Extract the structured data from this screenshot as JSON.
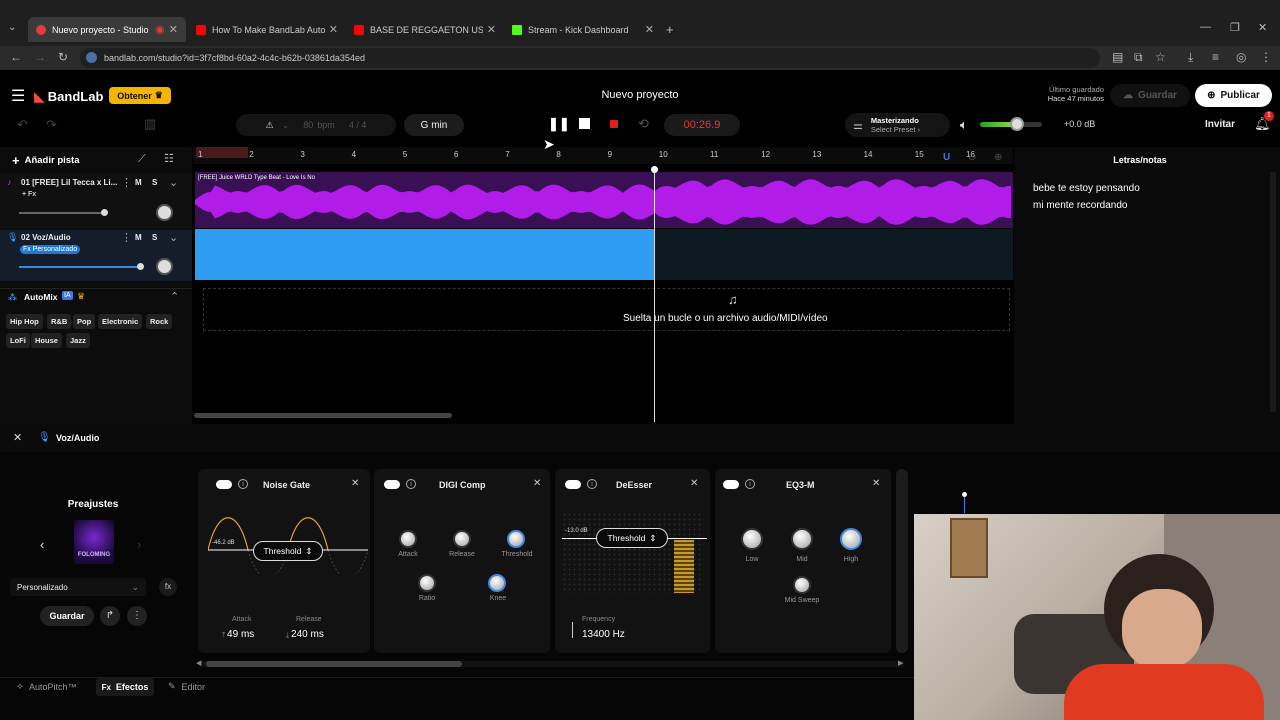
{
  "browser": {
    "tabs": [
      {
        "title": "Nuevo proyecto - Studio",
        "color": "#e23b3b",
        "active": true
      },
      {
        "title": "How To Make BandLab AutoTu",
        "color": "#ff0000"
      },
      {
        "title": "BASE DE REGGAETON USO LIB",
        "color": "#ff0000"
      },
      {
        "title": "Stream - Kick Dashboard",
        "color": "#53fc18"
      }
    ],
    "url": "bandlab.com/studio?id=3f7cf8bd-60a2-4c4c-b62b-03861da354ed"
  },
  "header": {
    "logo": "BandLab",
    "obtener": "Obtener",
    "project_title": "Nuevo proyecto",
    "last_saved_label": "Último guardado",
    "last_saved_time": "Hace 47 minutos",
    "save": "Guardar",
    "publish": "Publicar",
    "invite": "Invitar",
    "bell_badge": "1"
  },
  "transport": {
    "bpm": "80",
    "bpm_unit": "bpm",
    "time_sig": "4 / 4",
    "key": "G min",
    "time": "00:26.9",
    "master_title": "Masterizando",
    "master_sub": "Select Preset",
    "volume_db": "+0.0 dB",
    "volume_level": 0.6
  },
  "tracks": {
    "add": "Añadir pista",
    "items": [
      {
        "name": "01  [FREE] Lil Tecca x Li...",
        "fx": "+ Fx",
        "m": "M",
        "s": "S"
      },
      {
        "name": "02  Voz/Audio",
        "fx": "Fx Personalizado",
        "m": "M",
        "s": "S"
      }
    ],
    "clip1": "[FREE] Juice WRLD Type Beat - Love Is No",
    "drop": "Suelta un bucle o un archivo audio/MIDI/vídeo"
  },
  "automix": {
    "title": "AutoMix",
    "badge": "IA",
    "genres": [
      "Hip Hop",
      "R&B",
      "Pop",
      "Electronic",
      "Rock",
      "LoFi",
      "House",
      "Jazz"
    ]
  },
  "ruler": [
    "1",
    "2",
    "3",
    "4",
    "5",
    "6",
    "7",
    "8",
    "9",
    "10",
    "11",
    "12",
    "13",
    "14",
    "15",
    "16"
  ],
  "lyrics": {
    "title": "Letras/notas",
    "line1": "bebe te estoy pensando",
    "line2": "mi mente recordando"
  },
  "fx": {
    "track": "Voz/Audio",
    "presets_title": "Preajustes",
    "preset_name": "FOLOMING",
    "preset_select": "Personalizado",
    "save": "Guardar",
    "noise_gate": {
      "title": "Noise Gate",
      "db": "-46.2 dB",
      "param": "Threshold",
      "attack_label": "Attack",
      "attack": "49 ms",
      "release_label": "Release",
      "release": "240 ms"
    },
    "digi_comp": {
      "title": "DIGI Comp",
      "attack": "Attack",
      "release": "Release",
      "threshold": "Threshold",
      "ratio": "Ratio",
      "knee": "Knee"
    },
    "deesser": {
      "title": "DeEsser",
      "db": "-13.0 dB",
      "param": "Threshold",
      "freq_label": "Frequency",
      "freq": "13400 Hz"
    },
    "eq3": {
      "title": "EQ3-M",
      "low": "Low",
      "mid": "Mid",
      "high": "High",
      "sweep": "Mid Sweep"
    }
  },
  "bottom": {
    "autopitch": "AutoPitch™",
    "effects": "Efectos",
    "editor": "Editor"
  }
}
